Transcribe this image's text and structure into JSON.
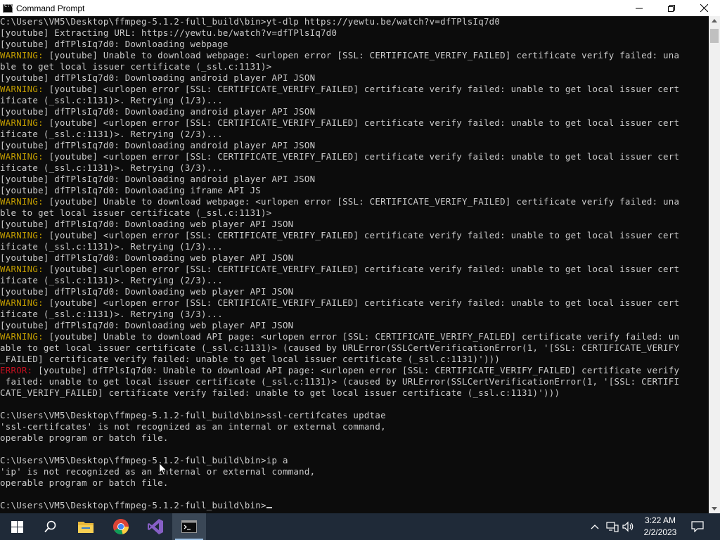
{
  "window": {
    "title": "Command Prompt",
    "icon": "cmd-icon"
  },
  "console_lines": [
    {
      "prefix": "",
      "text": "C:\\Users\\VM5\\Desktop\\ffmpeg-5.1.2-full_build\\bin>yt-dlp https://yewtu.be/watch?v=dfTPlsIq7d0"
    },
    {
      "prefix": "",
      "text": "[youtube] Extracting URL: https://yewtu.be/watch?v=dfTPlsIq7d0"
    },
    {
      "prefix": "",
      "text": "[youtube] dfTPlsIq7d0: Downloading webpage"
    },
    {
      "prefix": "WARNING:",
      "text": " [youtube] Unable to download webpage: <urlopen error [SSL: CERTIFICATE_VERIFY_FAILED] certificate verify failed: una"
    },
    {
      "prefix": "",
      "text": "ble to get local issuer certificate (_ssl.c:1131)>"
    },
    {
      "prefix": "",
      "text": "[youtube] dfTPlsIq7d0: Downloading android player API JSON"
    },
    {
      "prefix": "WARNING:",
      "text": " [youtube] <urlopen error [SSL: CERTIFICATE_VERIFY_FAILED] certificate verify failed: unable to get local issuer cert"
    },
    {
      "prefix": "",
      "text": "ificate (_ssl.c:1131)>. Retrying (1/3)..."
    },
    {
      "prefix": "",
      "text": "[youtube] dfTPlsIq7d0: Downloading android player API JSON"
    },
    {
      "prefix": "WARNING:",
      "text": " [youtube] <urlopen error [SSL: CERTIFICATE_VERIFY_FAILED] certificate verify failed: unable to get local issuer cert"
    },
    {
      "prefix": "",
      "text": "ificate (_ssl.c:1131)>. Retrying (2/3)..."
    },
    {
      "prefix": "",
      "text": "[youtube] dfTPlsIq7d0: Downloading android player API JSON"
    },
    {
      "prefix": "WARNING:",
      "text": " [youtube] <urlopen error [SSL: CERTIFICATE_VERIFY_FAILED] certificate verify failed: unable to get local issuer cert"
    },
    {
      "prefix": "",
      "text": "ificate (_ssl.c:1131)>. Retrying (3/3)..."
    },
    {
      "prefix": "",
      "text": "[youtube] dfTPlsIq7d0: Downloading android player API JSON"
    },
    {
      "prefix": "",
      "text": "[youtube] dfTPlsIq7d0: Downloading iframe API JS"
    },
    {
      "prefix": "WARNING:",
      "text": " [youtube] Unable to download webpage: <urlopen error [SSL: CERTIFICATE_VERIFY_FAILED] certificate verify failed: una"
    },
    {
      "prefix": "",
      "text": "ble to get local issuer certificate (_ssl.c:1131)>"
    },
    {
      "prefix": "",
      "text": "[youtube] dfTPlsIq7d0: Downloading web player API JSON"
    },
    {
      "prefix": "WARNING:",
      "text": " [youtube] <urlopen error [SSL: CERTIFICATE_VERIFY_FAILED] certificate verify failed: unable to get local issuer cert"
    },
    {
      "prefix": "",
      "text": "ificate (_ssl.c:1131)>. Retrying (1/3)..."
    },
    {
      "prefix": "",
      "text": "[youtube] dfTPlsIq7d0: Downloading web player API JSON"
    },
    {
      "prefix": "WARNING:",
      "text": " [youtube] <urlopen error [SSL: CERTIFICATE_VERIFY_FAILED] certificate verify failed: unable to get local issuer cert"
    },
    {
      "prefix": "",
      "text": "ificate (_ssl.c:1131)>. Retrying (2/3)..."
    },
    {
      "prefix": "",
      "text": "[youtube] dfTPlsIq7d0: Downloading web player API JSON"
    },
    {
      "prefix": "WARNING:",
      "text": " [youtube] <urlopen error [SSL: CERTIFICATE_VERIFY_FAILED] certificate verify failed: unable to get local issuer cert"
    },
    {
      "prefix": "",
      "text": "ificate (_ssl.c:1131)>. Retrying (3/3)..."
    },
    {
      "prefix": "",
      "text": "[youtube] dfTPlsIq7d0: Downloading web player API JSON"
    },
    {
      "prefix": "WARNING:",
      "text": " [youtube] Unable to download API page: <urlopen error [SSL: CERTIFICATE_VERIFY_FAILED] certificate verify failed: un"
    },
    {
      "prefix": "",
      "text": "able to get local issuer certificate (_ssl.c:1131)> (caused by URLError(SSLCertVerificationError(1, '[SSL: CERTIFICATE_VERIFY"
    },
    {
      "prefix": "",
      "text": "_FAILED] certificate verify failed: unable to get local issuer certificate (_ssl.c:1131)')))"
    },
    {
      "prefix": "ERROR:",
      "text": " [youtube] dfTPlsIq7d0: Unable to download API page: <urlopen error [SSL: CERTIFICATE_VERIFY_FAILED] certificate verify"
    },
    {
      "prefix": "",
      "text": " failed: unable to get local issuer certificate (_ssl.c:1131)> (caused by URLError(SSLCertVerificationError(1, '[SSL: CERTIFI"
    },
    {
      "prefix": "",
      "text": "CATE_VERIFY_FAILED] certificate verify failed: unable to get local issuer certificate (_ssl.c:1131)')))"
    },
    {
      "prefix": "",
      "text": ""
    },
    {
      "prefix": "",
      "text": "C:\\Users\\VM5\\Desktop\\ffmpeg-5.1.2-full_build\\bin>ssl-certifcates updtae"
    },
    {
      "prefix": "",
      "text": "'ssl-certifcates' is not recognized as an internal or external command,"
    },
    {
      "prefix": "",
      "text": "operable program or batch file."
    },
    {
      "prefix": "",
      "text": ""
    },
    {
      "prefix": "",
      "text": "C:\\Users\\VM5\\Desktop\\ffmpeg-5.1.2-full_build\\bin>ip a"
    },
    {
      "prefix": "",
      "text": "'ip' is not recognized as an internal or external command,"
    },
    {
      "prefix": "",
      "text": "operable program or batch file."
    },
    {
      "prefix": "",
      "text": ""
    },
    {
      "prefix": "",
      "text": "C:\\Users\\VM5\\Desktop\\ffmpeg-5.1.2-full_build\\bin>",
      "cursor": true
    }
  ],
  "colors": {
    "console_bg": "#0c0c0c",
    "console_fg": "#cccccc",
    "warning": "#c19c00",
    "error": "#c50f1f",
    "taskbar_bg": "#1f2a38"
  },
  "taskbar": {
    "items": [
      {
        "name": "start-button",
        "icon": "windows-logo-icon"
      },
      {
        "name": "search-button",
        "icon": "search-icon"
      },
      {
        "name": "file-explorer-button",
        "icon": "folder-icon"
      },
      {
        "name": "chrome-button",
        "icon": "chrome-icon"
      },
      {
        "name": "visual-studio-button",
        "icon": "visual-studio-icon"
      },
      {
        "name": "command-prompt-button",
        "icon": "cmd-icon",
        "active": true
      }
    ],
    "tray_icons": [
      "chevron-up-icon",
      "network-icon",
      "volume-icon"
    ],
    "time": "3:22 AM",
    "date": "2/2/2023"
  }
}
